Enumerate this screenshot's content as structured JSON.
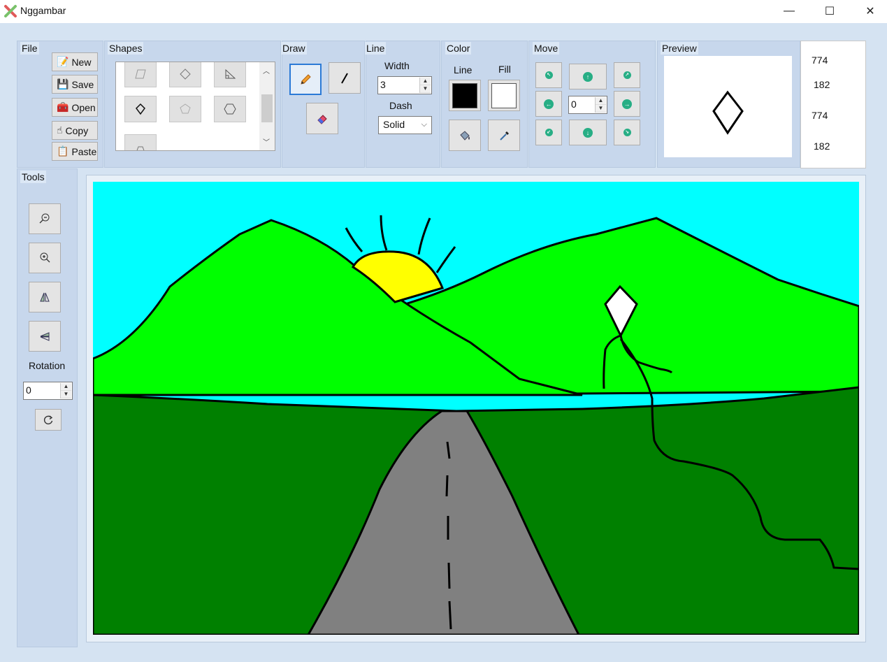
{
  "window": {
    "title": "Nggambar",
    "minimize": "—",
    "maximize": "☐",
    "close": "✕"
  },
  "file": {
    "label": "File",
    "buttons": [
      {
        "label": "New",
        "icon": "new-document-icon"
      },
      {
        "label": "Save",
        "icon": "save-disk-icon"
      },
      {
        "label": "Open",
        "icon": "open-folder-icon"
      },
      {
        "label": "Copy",
        "icon": "hand-cursor-icon"
      },
      {
        "label": "Paste",
        "icon": "paste-clipboard-icon"
      }
    ]
  },
  "shapes": {
    "label": "Shapes",
    "items": [
      "parallelogram",
      "diamond",
      "right-triangle",
      "kite",
      "pentagon",
      "hexagon",
      "trapezoid"
    ]
  },
  "draw": {
    "label": "Draw",
    "tools": [
      "pencil-icon",
      "line-icon",
      "eraser-icon"
    ]
  },
  "line": {
    "label": "Line",
    "width_label": "Width",
    "width_value": "3",
    "dash_label": "Dash",
    "dash_value": "Solid"
  },
  "color": {
    "label": "Color",
    "line_label": "Line",
    "fill_label": "Fill",
    "line_color": "#000000",
    "fill_color": "#ffffff"
  },
  "move": {
    "label": "Move",
    "step_value": "0"
  },
  "preview": {
    "label": "Preview",
    "values": [
      "774",
      "182",
      "774",
      "182"
    ]
  },
  "tools": {
    "label": "Tools",
    "rotation_label": "Rotation",
    "rotation_value": "0"
  },
  "canvas": {
    "colors": {
      "sky": "#00ffff",
      "hills": "#00ff00",
      "grass": "#008000",
      "road": "#808080",
      "sun": "#ffff00",
      "outline": "#000000"
    }
  }
}
